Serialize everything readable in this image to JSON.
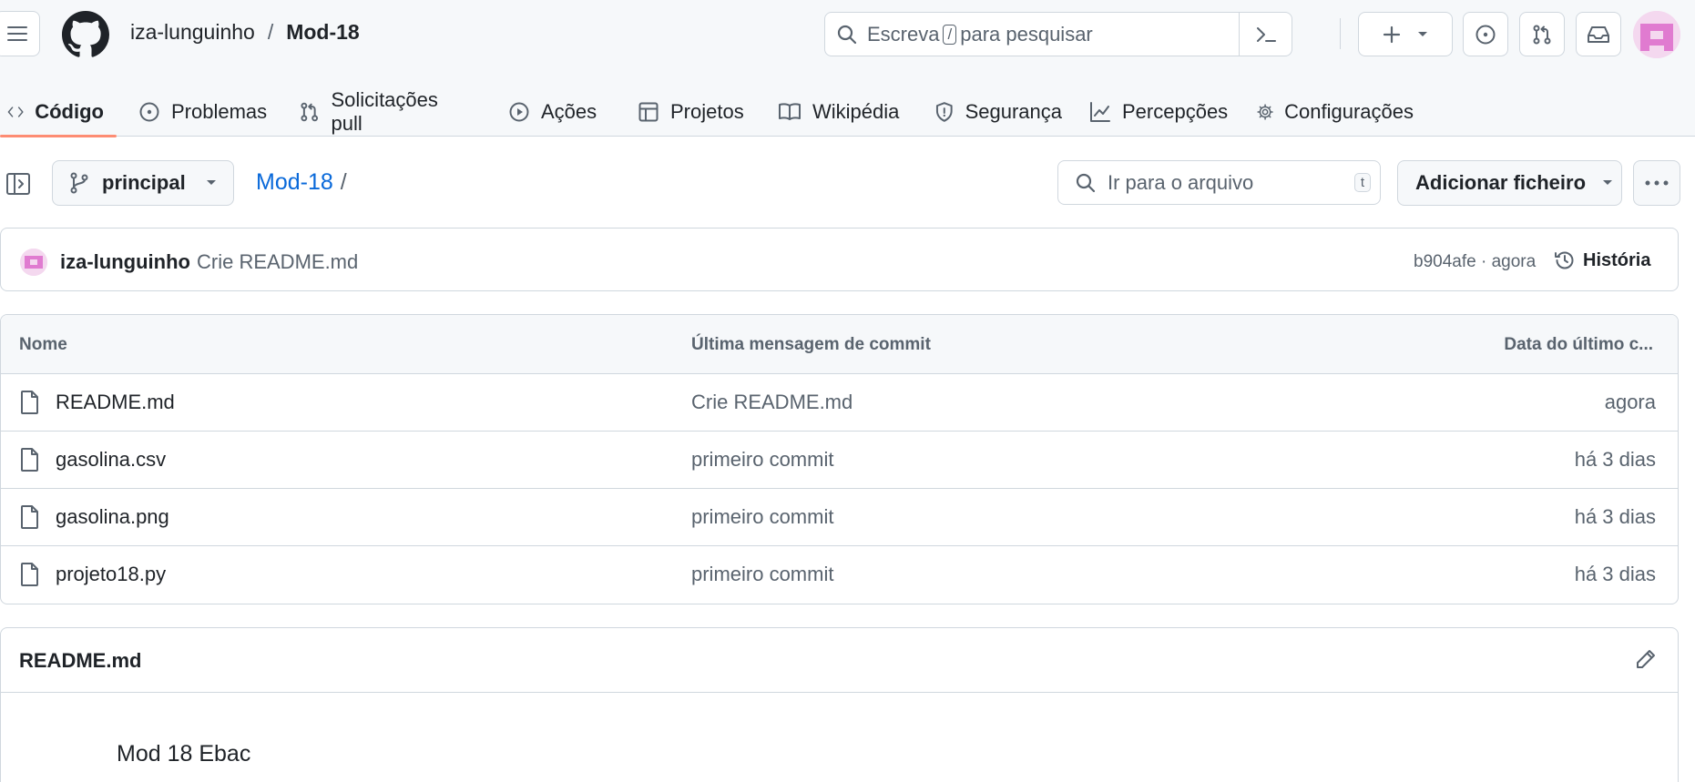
{
  "header": {
    "owner": "iza-lunguinho",
    "separator": "/",
    "repo": "Mod-18",
    "search": {
      "before": "Escreva",
      "key": "/",
      "after": "para pesquisar"
    }
  },
  "tabs": [
    {
      "label": "Código",
      "icon": "code-icon",
      "active": true
    },
    {
      "label": "Problemas",
      "icon": "issue-icon"
    },
    {
      "label": "Solicitações pull",
      "icon": "pull-request-icon"
    },
    {
      "label": "Ações",
      "icon": "play-icon"
    },
    {
      "label": "Projetos",
      "icon": "table-icon"
    },
    {
      "label": "Wikipédia",
      "icon": "book-icon"
    },
    {
      "label": "Segurança",
      "icon": "shield-icon"
    },
    {
      "label": "Percepções",
      "icon": "graph-icon"
    },
    {
      "label": "Configurações",
      "icon": "gear-icon"
    }
  ],
  "toolbar": {
    "branch": "principal",
    "breadcrumb_repo": "Mod-18",
    "breadcrumb_sep": "/",
    "goto_placeholder": "Ir para o arquivo",
    "goto_key": "t",
    "add_file": "Adicionar ficheiro"
  },
  "commit": {
    "author": "iza-lunguinho",
    "message": "Crie README.md",
    "meta": "b904afe · agora",
    "history": "História"
  },
  "files": {
    "columns": [
      "Nome",
      "Última mensagem de commit",
      "Data do último c..."
    ],
    "rows": [
      {
        "name": "README.md",
        "message": "Crie README.md",
        "date": "agora"
      },
      {
        "name": "gasolina.csv",
        "message": "primeiro commit",
        "date": "há 3 dias"
      },
      {
        "name": "gasolina.png",
        "message": "primeiro commit",
        "date": "há 3 dias"
      },
      {
        "name": "projeto18.py",
        "message": "primeiro commit",
        "date": "há 3 dias"
      }
    ]
  },
  "readme": {
    "title": "README.md",
    "content": "Mod 18 Ebac"
  },
  "colors": {
    "accent_link": "#0969da",
    "active_tab_underline": "#fd8c73",
    "avatar_pink": "#e07bd0"
  }
}
